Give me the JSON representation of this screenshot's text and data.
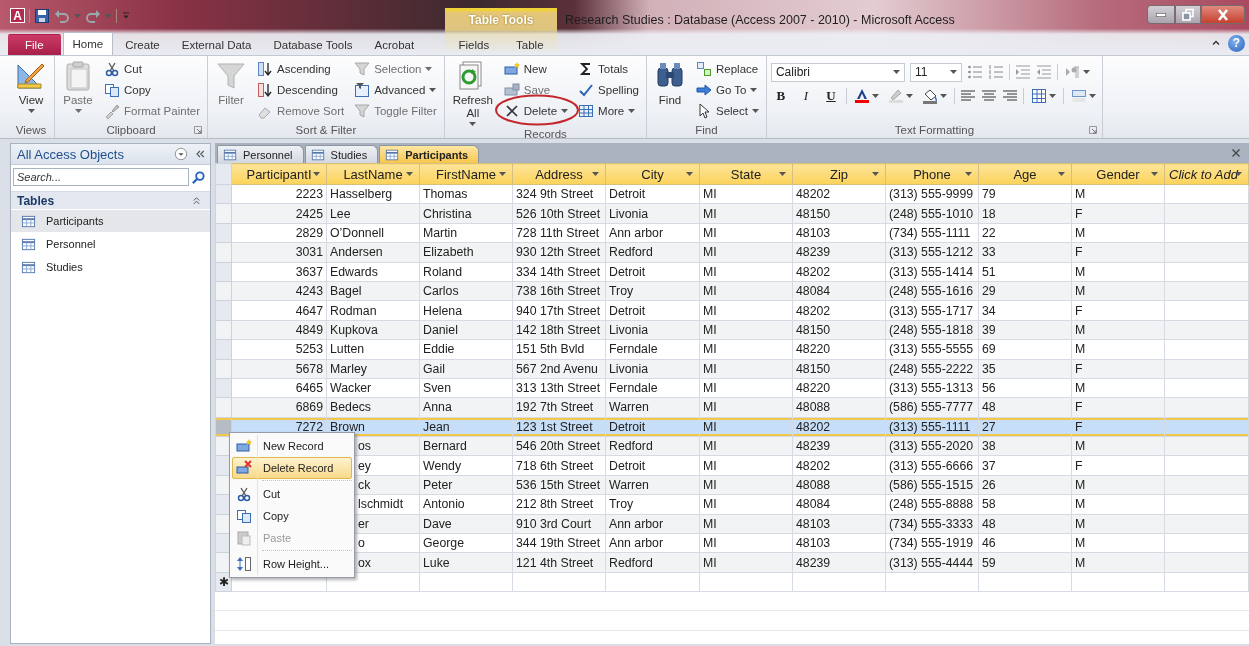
{
  "window": {
    "logo_letter": "A",
    "title": "Research Studies : Database (Access 2007 - 2010)  -  Microsoft Access",
    "help": "?"
  },
  "ribbon": {
    "contextual_title": "Table Tools",
    "tabs": [
      {
        "label": "File",
        "kind": "file",
        "selected": false
      },
      {
        "label": "Home",
        "kind": "normal",
        "selected": true
      },
      {
        "label": "Create",
        "kind": "normal",
        "selected": false
      },
      {
        "label": "External Data",
        "kind": "normal",
        "selected": false
      },
      {
        "label": "Database Tools",
        "kind": "normal",
        "selected": false
      },
      {
        "label": "Acrobat",
        "kind": "normal",
        "selected": false
      },
      {
        "label": "Fields",
        "kind": "contextual",
        "selected": false
      },
      {
        "label": "Table",
        "kind": "contextual",
        "selected": false
      }
    ],
    "groups": [
      {
        "label": "Views",
        "launcher": false,
        "items": [
          {
            "kind": "large",
            "label": "View",
            "dropdown": true,
            "disabled": false
          }
        ]
      },
      {
        "label": "Clipboard",
        "launcher": true,
        "items": [
          {
            "kind": "large",
            "label": "Paste",
            "dropdown": true,
            "disabled": true
          },
          {
            "kind": "column",
            "items": [
              {
                "label": "Cut",
                "dropdown": false,
                "disabled": false
              },
              {
                "label": "Copy",
                "dropdown": false,
                "disabled": false
              },
              {
                "label": "Format Painter",
                "dropdown": false,
                "disabled": true
              }
            ]
          }
        ]
      },
      {
        "label": "Sort & Filter",
        "launcher": false,
        "items": [
          {
            "kind": "large",
            "label": "Filter",
            "dropdown": false,
            "disabled": true
          },
          {
            "kind": "column",
            "items": [
              {
                "label": "Ascending",
                "dropdown": false,
                "disabled": false
              },
              {
                "label": "Descending",
                "dropdown": false,
                "disabled": false
              },
              {
                "label": "Remove Sort",
                "dropdown": false,
                "disabled": true
              }
            ]
          },
          {
            "kind": "column",
            "items": [
              {
                "label": "Selection",
                "dropdown": true,
                "disabled": true
              },
              {
                "label": "Advanced",
                "dropdown": true,
                "disabled": false
              },
              {
                "label": "Toggle Filter",
                "dropdown": false,
                "disabled": true
              }
            ]
          }
        ]
      },
      {
        "label": "Records",
        "launcher": false,
        "items": [
          {
            "kind": "large",
            "label": "Refresh All",
            "dropdown": true,
            "disabled": false
          },
          {
            "kind": "column",
            "items": [
              {
                "label": "New",
                "dropdown": false,
                "disabled": false
              },
              {
                "label": "Save",
                "dropdown": false,
                "disabled": true
              },
              {
                "label": "Delete",
                "dropdown": true,
                "disabled": false
              }
            ]
          },
          {
            "kind": "column",
            "items": [
              {
                "label": "Totals",
                "dropdown": false,
                "disabled": false
              },
              {
                "label": "Spelling",
                "dropdown": false,
                "disabled": false
              },
              {
                "label": "More",
                "dropdown": true,
                "disabled": false
              }
            ]
          }
        ]
      },
      {
        "label": "Find",
        "launcher": false,
        "items": [
          {
            "kind": "large",
            "label": "Find",
            "dropdown": false,
            "disabled": false
          },
          {
            "kind": "column",
            "items": [
              {
                "label": "Replace",
                "dropdown": false,
                "disabled": false
              },
              {
                "label": "Go To",
                "dropdown": true,
                "disabled": false
              },
              {
                "label": "Select",
                "dropdown": true,
                "disabled": false
              }
            ]
          }
        ]
      },
      {
        "label": "Text Formatting",
        "launcher": true,
        "items": [
          {
            "kind": "format",
            "font": "Calibri",
            "size": "11",
            "bold": "B",
            "italic": "I",
            "underline": "U"
          }
        ]
      }
    ]
  },
  "annotation": {
    "kind": "ellipse"
  },
  "nav": {
    "title": "All Access Objects",
    "search_placeholder": "Search...",
    "groups": [
      {
        "label": "Tables",
        "expanded": true,
        "items": [
          {
            "label": "Participants",
            "selected": true
          },
          {
            "label": "Personnel",
            "selected": false
          },
          {
            "label": "Studies",
            "selected": false
          }
        ]
      }
    ]
  },
  "doc_tabs": [
    {
      "label": "Personnel",
      "selected": false
    },
    {
      "label": "Studies",
      "selected": false
    },
    {
      "label": "Participants",
      "selected": true
    }
  ],
  "table": {
    "new_row_marker": "✱",
    "columns": [
      {
        "label": "ParticipantI",
        "kind": "field"
      },
      {
        "label": "LastName",
        "kind": "field"
      },
      {
        "label": "FirstName",
        "kind": "field"
      },
      {
        "label": "Address",
        "kind": "field"
      },
      {
        "label": "City",
        "kind": "field"
      },
      {
        "label": "State",
        "kind": "field"
      },
      {
        "label": "Zip",
        "kind": "field"
      },
      {
        "label": "Phone",
        "kind": "field"
      },
      {
        "label": "Age",
        "kind": "field"
      },
      {
        "label": "Gender",
        "kind": "field"
      },
      {
        "label": "Click to Add",
        "kind": "add"
      }
    ],
    "rows": [
      {
        "selected": false,
        "cells": [
          "2223",
          "Hasselberg",
          "Thomas",
          "324 9th Street",
          "Detroit",
          "MI",
          "48202",
          "(313) 555-9999",
          "79",
          "M"
        ]
      },
      {
        "selected": false,
        "cells": [
          "2425",
          "Lee",
          "Christina",
          "526 10th Street",
          "Livonia",
          "MI",
          "48150",
          "(248) 555-1010",
          "18",
          "F"
        ]
      },
      {
        "selected": false,
        "cells": [
          "2829",
          "O’Donnell",
          "Martin",
          "728 11th Street",
          "Ann arbor",
          "MI",
          "48103",
          "(734) 555-1111",
          "22",
          "M"
        ]
      },
      {
        "selected": false,
        "cells": [
          "3031",
          "Andersen",
          "Elizabeth",
          "930 12th Street",
          "Redford",
          "MI",
          "48239",
          "(313) 555-1212",
          "33",
          "F"
        ]
      },
      {
        "selected": false,
        "cells": [
          "3637",
          "Edwards",
          "Roland",
          "334 14th Street",
          "Detroit",
          "MI",
          "48202",
          "(313) 555-1414",
          "51",
          "M"
        ]
      },
      {
        "selected": false,
        "cells": [
          "4243",
          "Bagel",
          "Carlos",
          "738 16th Street",
          "Troy",
          "MI",
          "48084",
          "(248) 555-1616",
          "29",
          "M"
        ]
      },
      {
        "selected": false,
        "cells": [
          "4647",
          "Rodman",
          "Helena",
          "940 17th Street",
          "Detroit",
          "MI",
          "48202",
          "(313) 555-1717",
          "34",
          "F"
        ]
      },
      {
        "selected": false,
        "cells": [
          "4849",
          "Kupkova",
          "Daniel",
          "142 18th Street",
          "Livonia",
          "MI",
          "48150",
          "(248) 555-1818",
          "39",
          "M"
        ]
      },
      {
        "selected": false,
        "cells": [
          "5253",
          "Lutten",
          "Eddie",
          "151 5th Bvld",
          "Ferndale",
          "MI",
          "48220",
          "(313) 555-5555",
          "69",
          "M"
        ]
      },
      {
        "selected": false,
        "cells": [
          "5678",
          "Marley",
          "Gail",
          "567 2nd Avenu",
          "Livonia",
          "MI",
          "48150",
          "(248) 555-2222",
          "35",
          "F"
        ]
      },
      {
        "selected": false,
        "cells": [
          "6465",
          "Wacker",
          "Sven",
          "313 13th Street",
          "Ferndale",
          "MI",
          "48220",
          "(313) 555-1313",
          "56",
          "M"
        ]
      },
      {
        "selected": false,
        "cells": [
          "6869",
          "Bedecs",
          "Anna",
          "192 7th Street",
          "Warren",
          "MI",
          "48088",
          "(586) 555-7777",
          "48",
          "F"
        ]
      },
      {
        "selected": true,
        "cells": [
          "7272",
          "Brown",
          "Jean",
          "123 1st Street",
          "Detroit",
          "MI",
          "48202",
          "(313) 555-1111",
          "27",
          "F"
        ]
      },
      {
        "selected": false,
        "cells": [
          "",
          "os",
          "Bernard",
          "546 20th Street",
          "Redford",
          "MI",
          "48239",
          "(313) 555-2020",
          "38",
          "M"
        ]
      },
      {
        "selected": false,
        "cells": [
          "",
          "ey",
          "Wendy",
          "718 6th Street",
          "Detroit",
          "MI",
          "48202",
          "(313) 555-6666",
          "37",
          "F"
        ]
      },
      {
        "selected": false,
        "cells": [
          "",
          "ck",
          "Peter",
          "536 15th Street",
          "Warren",
          "MI",
          "48088",
          "(586) 555-1515",
          "26",
          "M"
        ]
      },
      {
        "selected": false,
        "cells": [
          "",
          "lschmidt",
          "Antonio",
          "212 8th Street",
          "Troy",
          "MI",
          "48084",
          "(248) 555-8888",
          "58",
          "M"
        ]
      },
      {
        "selected": false,
        "cells": [
          "",
          "er",
          "Dave",
          "910 3rd Court",
          "Ann arbor",
          "MI",
          "48103",
          "(734) 555-3333",
          "48",
          "M"
        ]
      },
      {
        "selected": false,
        "cells": [
          "",
          "o",
          "George",
          "344 19th Street",
          "Ann arbor",
          "MI",
          "48103",
          "(734) 555-1919",
          "46",
          "M"
        ]
      },
      {
        "selected": false,
        "cells": [
          "",
          "ox",
          "Luke",
          "121 4th Street",
          "Redford",
          "MI",
          "48239",
          "(313) 555-4444",
          "59",
          "M"
        ]
      }
    ]
  },
  "context_menu": {
    "items": [
      {
        "kind": "item",
        "label": "New Record",
        "selected": false,
        "disabled": false
      },
      {
        "kind": "item",
        "label": "Delete Record",
        "selected": true,
        "disabled": false
      },
      {
        "kind": "separator"
      },
      {
        "kind": "item",
        "label": "Cut",
        "selected": false,
        "disabled": false
      },
      {
        "kind": "item",
        "label": "Copy",
        "selected": false,
        "disabled": false
      },
      {
        "kind": "item",
        "label": "Paste",
        "selected": false,
        "disabled": true
      },
      {
        "kind": "separator"
      },
      {
        "kind": "item",
        "label": "Row Height...",
        "selected": false,
        "disabled": false
      }
    ]
  }
}
